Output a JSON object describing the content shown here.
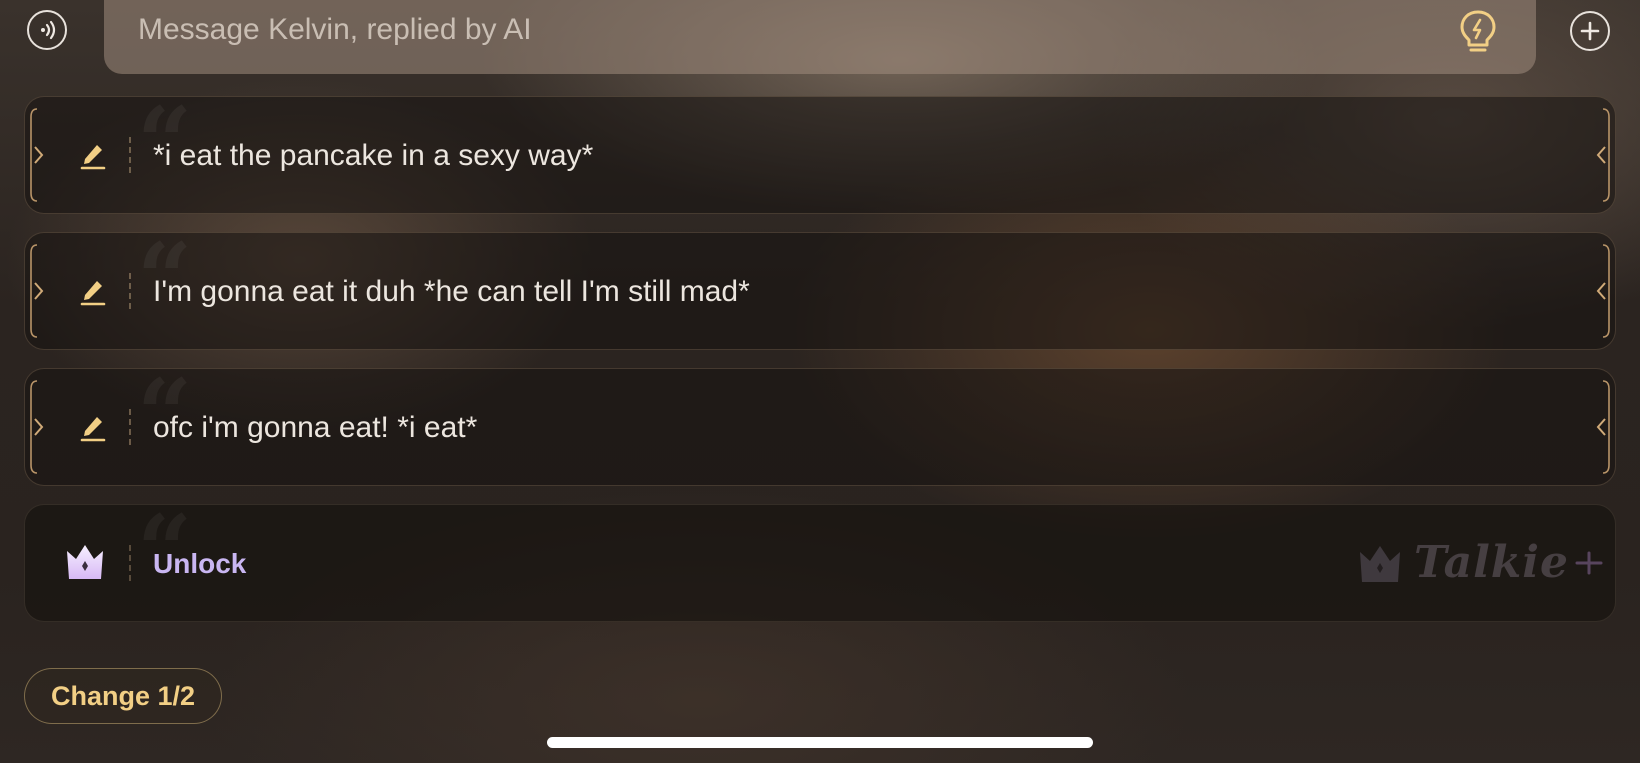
{
  "composer": {
    "placeholder": "Message Kelvin, replied by AI",
    "voice_icon": "voice-wave-icon",
    "idea_icon": "lightbulb-icon",
    "add_icon": "plus-circle-icon"
  },
  "suggestions": [
    {
      "text": "*i eat the pancake in a sexy way*",
      "icon": "pencil-edit-icon"
    },
    {
      "text": "I'm gonna eat it duh *he can tell I'm still mad*",
      "icon": "pencil-edit-icon"
    },
    {
      "text": "ofc i'm gonna eat! *i eat*",
      "icon": "pencil-edit-icon"
    }
  ],
  "unlock": {
    "label": "Unlock",
    "icon": "crown-icon",
    "brand": "Talkie",
    "brand_icon": "sparkle-plus-icon"
  },
  "change_button": {
    "label": "Change 1/2"
  },
  "colors": {
    "accent_gold": "#f2cf85",
    "unlock_purple": "#c9b6f2",
    "text_primary": "#ece6df"
  }
}
